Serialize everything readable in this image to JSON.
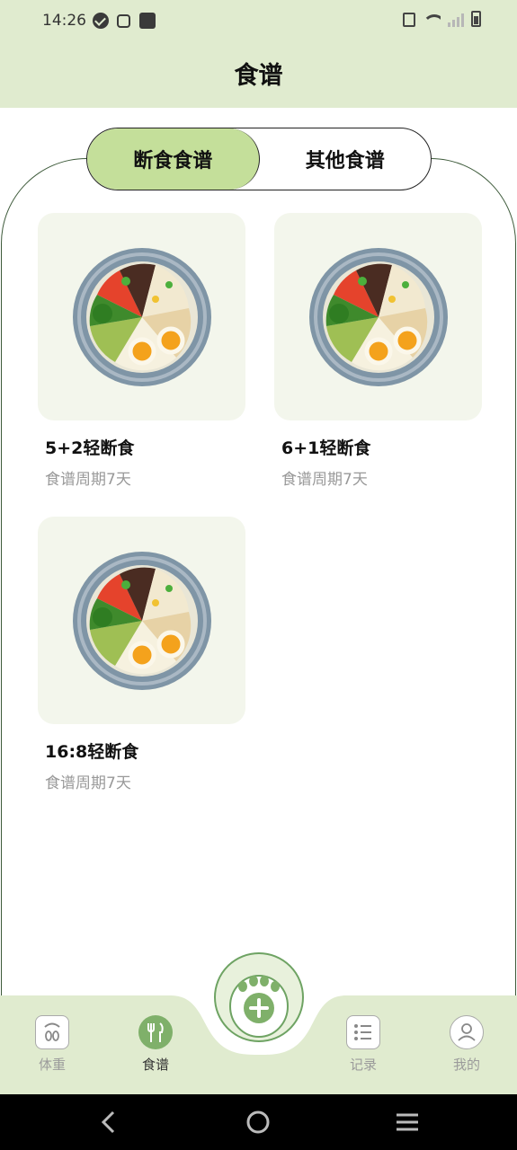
{
  "status": {
    "time": "14:26"
  },
  "header": {
    "title": "食谱"
  },
  "tabs": [
    {
      "label": "断食食谱",
      "active": true
    },
    {
      "label": "其他食谱",
      "active": false
    }
  ],
  "recipes": [
    {
      "title": "5+2轻断食",
      "subtitle": "食谱周期7天"
    },
    {
      "title": "6+1轻断食",
      "subtitle": "食谱周期7天"
    },
    {
      "title": "16:8轻断食",
      "subtitle": "食谱周期7天"
    }
  ],
  "nav": {
    "items": [
      {
        "label": "体重",
        "icon": "scale-icon",
        "active": false
      },
      {
        "label": "食谱",
        "icon": "cutlery-icon",
        "active": true
      },
      {
        "label": "记录",
        "icon": "list-icon",
        "active": false
      },
      {
        "label": "我的",
        "icon": "profile-icon",
        "active": false
      }
    ],
    "center_icon": "paw-add-icon"
  },
  "colors": {
    "header_bg": "#e0ebcf",
    "accent": "#c4df9a",
    "card_bg": "#f3f6ec",
    "nav_active": "#7fb06a"
  }
}
